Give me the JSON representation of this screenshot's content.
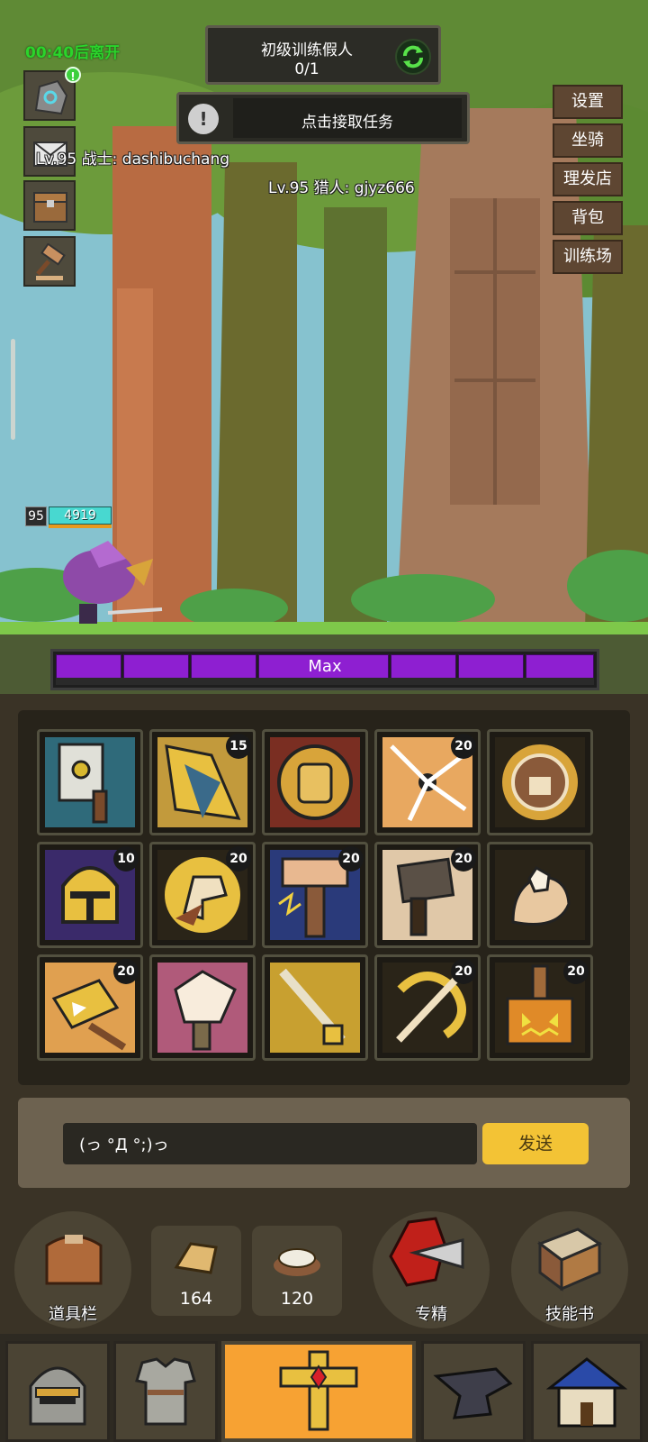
{
  "hud": {
    "leave_timer": "00:40后离开",
    "quest": {
      "title": "初级训练假人",
      "progress": "0/1"
    },
    "task_button": "点击接取任务",
    "players": [
      {
        "label": "Lv.95 战士: dashibuchang"
      },
      {
        "label": "Lv.95 猎人: gjyz666"
      }
    ],
    "player_level": "95",
    "player_hp": "4919",
    "combo_bar": {
      "label": "Max",
      "fill_fraction": 1.0
    }
  },
  "right_menu": [
    "设置",
    "坐骑",
    "理发店",
    "背包",
    "训练场"
  ],
  "skills": [
    {
      "icon": "hammer-skill-icon",
      "count": ""
    },
    {
      "icon": "shattered-wave-skill-icon",
      "count": "15"
    },
    {
      "icon": "fist-shield-skill-icon",
      "count": ""
    },
    {
      "icon": "shatter-burst-skill-icon",
      "count": "20"
    },
    {
      "icon": "golden-punch-skill-icon",
      "count": ""
    },
    {
      "icon": "golden-helmet-skill-icon",
      "count": "10"
    },
    {
      "icon": "horse-head-skill-icon",
      "count": "20"
    },
    {
      "icon": "lightning-hammer-skill-icon",
      "count": "20"
    },
    {
      "icon": "dark-hammer-skill-icon",
      "count": "20"
    },
    {
      "icon": "open-hand-skill-icon",
      "count": ""
    },
    {
      "icon": "golden-block-skill-icon",
      "count": "20"
    },
    {
      "icon": "white-hammer-skill-icon",
      "count": ""
    },
    {
      "icon": "golden-sword-skill-icon",
      "count": ""
    },
    {
      "icon": "spinning-blade-skill-icon",
      "count": "20"
    },
    {
      "icon": "pumpkin-hammer-skill-icon",
      "count": "20"
    }
  ],
  "chat": {
    "input_value": "(っ °Д °;)っ",
    "send_label": "发送"
  },
  "tools": {
    "item_bar_label": "道具栏",
    "bread_count": "164",
    "fish_count": "120",
    "specialization_label": "专精",
    "skill_book_label": "技能书"
  },
  "nav_tabs": [
    {
      "icon": "helmet-icon"
    },
    {
      "icon": "armor-icon"
    },
    {
      "icon": "cross-sword-icon",
      "active": true
    },
    {
      "icon": "anvil-icon"
    },
    {
      "icon": "house-icon"
    }
  ],
  "colors": {
    "timer_green": "#2bd42b",
    "combo_purple": "#8e1fd1",
    "send_yellow": "#f3c335",
    "active_tab_orange": "#f7a233"
  }
}
